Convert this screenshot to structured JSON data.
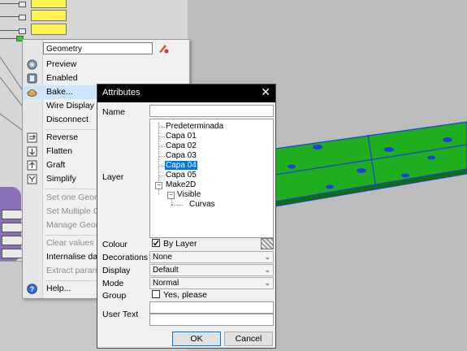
{
  "context_menu": {
    "name_value": "Geometry",
    "items": [
      {
        "label": "Preview",
        "icon": "preview-icon",
        "enabled": true
      },
      {
        "label": "Enabled",
        "icon": "enabled-icon",
        "enabled": true
      },
      {
        "label": "Bake...",
        "icon": "bake-icon",
        "enabled": true,
        "highlight": true
      },
      {
        "label": "Wire Display",
        "icon": "",
        "enabled": true
      },
      {
        "label": "Disconnect",
        "icon": "",
        "enabled": true
      },
      {
        "label": "Reverse",
        "icon": "reverse-icon",
        "enabled": true
      },
      {
        "label": "Flatten",
        "icon": "flatten-icon",
        "enabled": true
      },
      {
        "label": "Graft",
        "icon": "graft-icon",
        "enabled": true
      },
      {
        "label": "Simplify",
        "icon": "simplify-icon",
        "enabled": true
      },
      {
        "label": "Set one Geome",
        "icon": "",
        "enabled": false
      },
      {
        "label": "Set Multiple Ge",
        "icon": "",
        "enabled": false
      },
      {
        "label": "Manage Geome",
        "icon": "",
        "enabled": false
      },
      {
        "label": "Clear values",
        "icon": "",
        "enabled": false
      },
      {
        "label": "Internalise data",
        "icon": "",
        "enabled": true
      },
      {
        "label": "Extract paramet",
        "icon": "",
        "enabled": false
      },
      {
        "label": "Help...",
        "icon": "help-icon",
        "enabled": true
      }
    ]
  },
  "dialog": {
    "title": "Attributes",
    "labels": {
      "name": "Name",
      "layer": "Layer",
      "colour": "Colour",
      "decorations": "Decorations",
      "display": "Display",
      "mode": "Mode",
      "group": "Group",
      "user_text": "User Text"
    },
    "name_value": "",
    "layers": [
      {
        "label": "Predeterminada",
        "depth": 0,
        "selected": false
      },
      {
        "label": "Capa 01",
        "depth": 0,
        "selected": false
      },
      {
        "label": "Capa 02",
        "depth": 0,
        "selected": false
      },
      {
        "label": "Capa 03",
        "depth": 0,
        "selected": false
      },
      {
        "label": "Capa 04",
        "depth": 0,
        "selected": true
      },
      {
        "label": "Capa 05",
        "depth": 0,
        "selected": false
      },
      {
        "label": "Make2D",
        "depth": 0,
        "selected": false,
        "expanded": true
      },
      {
        "label": "Visible",
        "depth": 1,
        "selected": false,
        "expanded": true
      },
      {
        "label": "Curvas",
        "depth": 2,
        "selected": false
      }
    ],
    "colour": {
      "checked": true,
      "label": "By Layer"
    },
    "decorations_value": "None",
    "display_value": "Default",
    "mode_value": "Normal",
    "group": {
      "checked": false,
      "label": "Yes, please"
    },
    "user_text_key": "",
    "user_text_value": "",
    "ok_label": "OK",
    "cancel_label": "Cancel"
  },
  "colors": {
    "slider_yellow": "#fff44f",
    "plate_green": "#1fae1f",
    "plate_edge_blue": "#1f3fd9",
    "selection_blue": "#0078d7",
    "menu_highlight": "#cde5fb"
  }
}
